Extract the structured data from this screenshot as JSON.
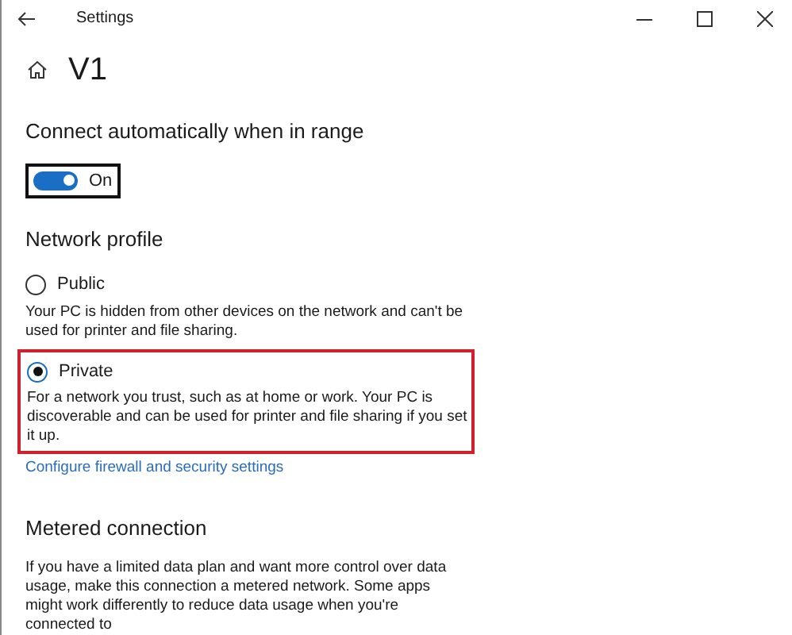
{
  "window": {
    "title": "Settings"
  },
  "page": {
    "title": "V1"
  },
  "auto_connect": {
    "heading": "Connect automatically when in range",
    "on": true,
    "label": "On"
  },
  "network_profile": {
    "heading": "Network profile",
    "options": [
      {
        "label": "Public",
        "selected": false,
        "highlighted": false,
        "description": "Your PC is hidden from other devices on the network and can't be used for printer and file sharing."
      },
      {
        "label": "Private",
        "selected": true,
        "highlighted": true,
        "description": "For a network you trust, such as at home or work. Your PC is discoverable and can be used for printer and file sharing if you set it up."
      }
    ],
    "link": "Configure firewall and security settings"
  },
  "metered": {
    "heading": "Metered connection",
    "description": "If you have a limited data plan and want more control over data usage, make this connection a metered network. Some apps might work differently to reduce data usage when you're connected to"
  }
}
